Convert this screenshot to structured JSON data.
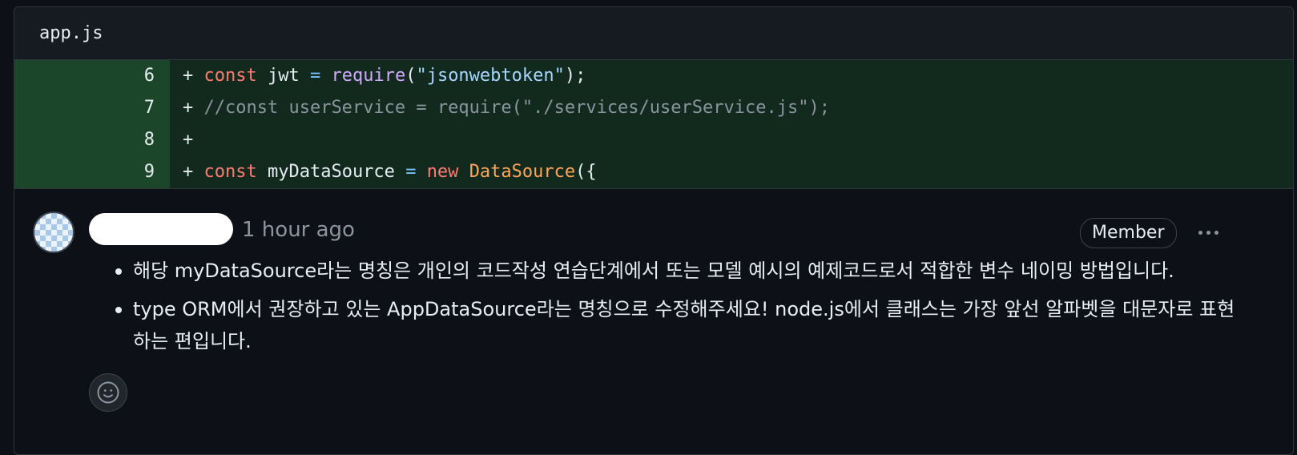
{
  "file": {
    "name": "app.js"
  },
  "code_lines": [
    {
      "number": "6",
      "marker": "+",
      "tokens": [
        "const",
        "jwt",
        "=",
        "require",
        "(",
        "\"jsonwebtoken\"",
        ");"
      ]
    },
    {
      "number": "7",
      "marker": "+",
      "text": "//const userService = require(\"./services/userService.js\");"
    },
    {
      "number": "8",
      "marker": "+",
      "text": ""
    },
    {
      "number": "9",
      "marker": "+",
      "tokens": [
        "const",
        "myDataSource",
        "=",
        "new",
        "DataSource",
        "({"
      ]
    }
  ],
  "comment": {
    "time": "1 hour ago",
    "role_badge": "Member",
    "bullets": [
      "해당 myDataSource라는 명칭은 개인의 코드작성 연습단계에서 또는 모델 예시의 예제코드로서 적합한 변수 네이밍 방법입니다.",
      "type ORM에서 권장하고 있는 AppDataSource라는 명칭으로 수정해주세요! node.js에서 클래스는 가장 앞선 알파벳을 대문자로 표현하는 편입니다."
    ]
  },
  "icons": {
    "more": "kebab-horizontal-icon",
    "reaction": "smiley-icon"
  },
  "colors": {
    "background": "#0d1117",
    "added_line": "#1f3a26",
    "keyword": "#ff7b72",
    "string": "#a5d6ff",
    "function": "#d2a8ff",
    "class": "#ffa657",
    "comment": "#8b949e"
  }
}
